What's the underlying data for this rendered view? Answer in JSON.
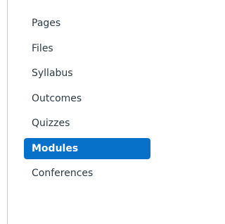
{
  "course_nav": {
    "items": [
      {
        "label": "Pages",
        "active": false
      },
      {
        "label": "Files",
        "active": false
      },
      {
        "label": "Syllabus",
        "active": false
      },
      {
        "label": "Outcomes",
        "active": false
      },
      {
        "label": "Quizzes",
        "active": false
      },
      {
        "label": "Modules",
        "active": true
      },
      {
        "label": "Conferences",
        "active": false
      }
    ]
  },
  "colors": {
    "active_background": "#0770c8",
    "active_text": "#ffffff",
    "text": "#2d3b45",
    "divider": "#c7cdd1"
  }
}
